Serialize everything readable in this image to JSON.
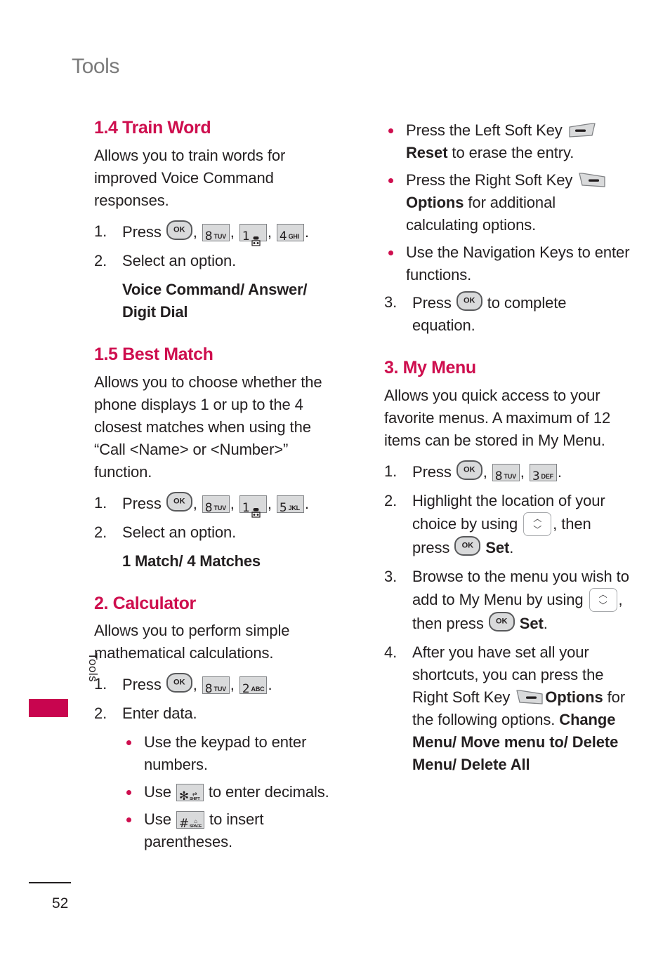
{
  "page": {
    "running_head": "Tools",
    "side_tab_label": "Tools",
    "page_number": "52",
    "accent_color": "#ce0e4e",
    "tab_color": "#c8054f"
  },
  "left_column": {
    "s14": {
      "heading": "1.4 Train Word",
      "intro": "Allows you to train words for improved Voice Command responses.",
      "step1_num": "1.",
      "step1_label": "Press",
      "step1_keys": [
        {
          "icon": "key-ok",
          "digit": "OK"
        },
        {
          "icon": "key-8",
          "digit": "8",
          "letters": "TUV"
        },
        {
          "icon": "key-1",
          "digit": "1",
          "letters": ""
        },
        {
          "icon": "key-4",
          "digit": "4",
          "letters": "GHI"
        }
      ],
      "step2_num": "2.",
      "step2_text": "Select an option.",
      "options": "Voice Command/ Answer/ Digit Dial"
    },
    "s15": {
      "heading": "1.5 Best Match",
      "intro": "Allows you to choose whether the phone displays 1 or up to the 4 closest matches when using the “Call <Name> or <Number>” function.",
      "step1_num": "1.",
      "step1_label": "Press",
      "step1_keys": [
        {
          "icon": "key-ok",
          "digit": "OK"
        },
        {
          "icon": "key-8",
          "digit": "8",
          "letters": "TUV"
        },
        {
          "icon": "key-1",
          "digit": "1",
          "letters": ""
        },
        {
          "icon": "key-5",
          "digit": "5",
          "letters": "JKL"
        }
      ],
      "step2_num": "2.",
      "step2_text": "Select an option.",
      "options": "1 Match/ 4 Matches"
    },
    "s2": {
      "heading": "2. Calculator",
      "intro": "Allows you to perform simple mathematical calculations.",
      "step1_num": "1.",
      "step1_label": "Press",
      "step1_keys": [
        {
          "icon": "key-ok",
          "digit": "OK"
        },
        {
          "icon": "key-8",
          "digit": "8",
          "letters": "TUV"
        },
        {
          "icon": "key-2",
          "digit": "2",
          "letters": "ABC"
        }
      ],
      "step2_num": "2.",
      "step2_text": "Enter data.",
      "bullets": [
        {
          "before": "Use the keypad to enter numbers.",
          "key": "",
          "after": ""
        },
        {
          "before": "Use ",
          "key": "star-key",
          "after": " to enter decimals."
        },
        {
          "before": "Use ",
          "key": "hash-key",
          "after": " to insert parentheses."
        }
      ]
    }
  },
  "right_column": {
    "calc_bullets": [
      {
        "before": "Press the Left Soft Key ",
        "key": "left-soft-key",
        "bold": "Reset",
        "after": " to erase the entry."
      },
      {
        "before": "Press the Right Soft Key ",
        "key": "right-soft-key",
        "bold": "Options",
        "after": " for additional calculating options."
      },
      {
        "before": "Use the Navigation Keys to enter functions.",
        "key": "",
        "bold": "",
        "after": ""
      }
    ],
    "calc_step3_num": "3.",
    "calc_step3_before": "Press ",
    "calc_step3_after": " to complete equation.",
    "s3": {
      "heading": "3. My Menu",
      "intro": "Allows you quick access to your favorite menus. A maximum of 12 items can be stored in My Menu.",
      "step1_num": "1.",
      "step1_label": "Press",
      "step1_keys": [
        {
          "icon": "key-ok",
          "digit": "OK"
        },
        {
          "icon": "key-8",
          "digit": "8",
          "letters": "TUV"
        },
        {
          "icon": "key-3",
          "digit": "3",
          "letters": "DEF"
        }
      ],
      "step2_num": "2.",
      "step2_a": "Highlight the location of your choice by using ",
      "step2_b": ", then press ",
      "step2_bold": "Set",
      "step2_c": ".",
      "step3_num": "3.",
      "step3_a": "Browse to the menu you wish to add to My Menu by using ",
      "step3_b": ", then press ",
      "step3_bold": "Set",
      "step3_c": ".",
      "step4_num": "4.",
      "step4_a": "After you have set all your shortcuts, you can press the Right Soft Key ",
      "step4_bold": "Options",
      "step4_b": " for the following options.",
      "step4_options": "Change Menu/ Move menu to/ Delete Menu/ Delete All"
    }
  }
}
